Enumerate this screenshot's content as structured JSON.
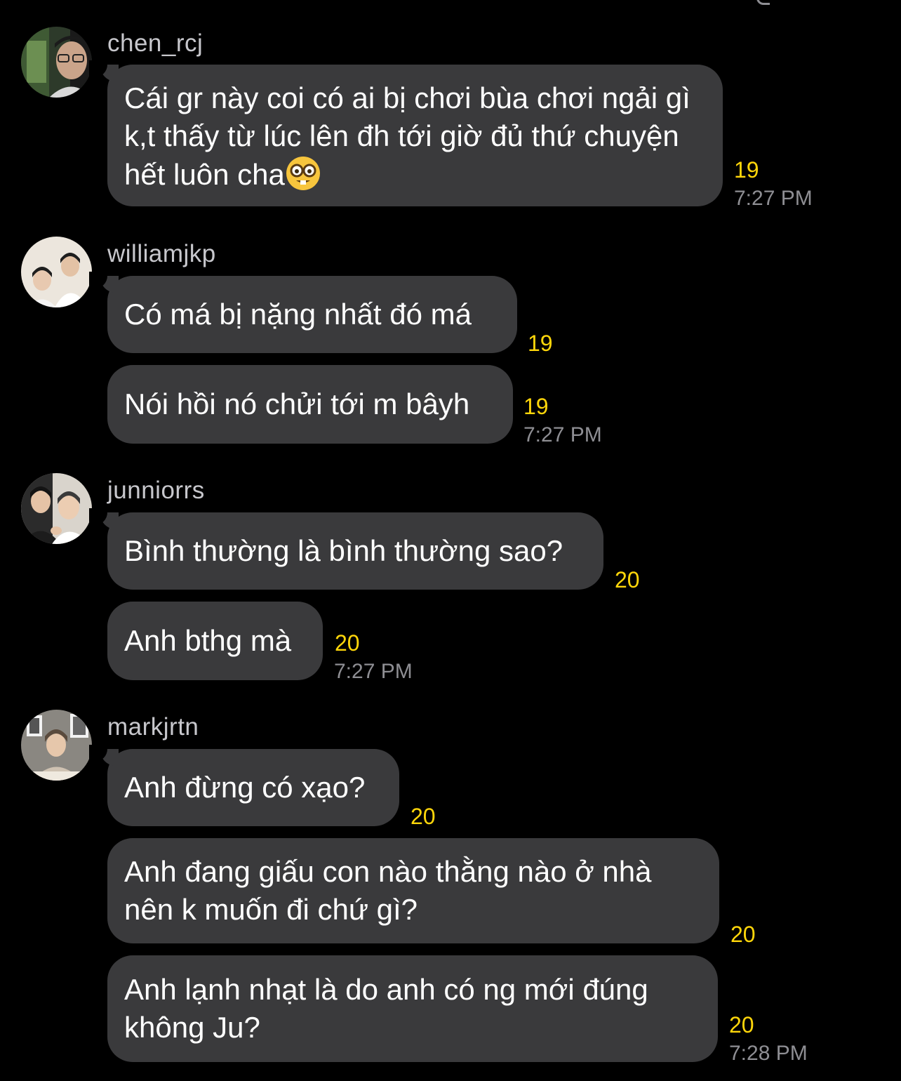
{
  "colors": {
    "background": "#000000",
    "bubble": "#3a3a3c",
    "text": "#ffffff",
    "username": "#c7c7cc",
    "read_count": "#ffd60a",
    "timestamp": "#8e8e93"
  },
  "messages": [
    {
      "user": "chen_rcj",
      "avatar_icon": "avatar-chen_rcj-icon",
      "bubbles": [
        {
          "text": "Cái gr này coi có ai bị chơi bùa chơi ngải gì k,t thấy từ lúc lên đh tới giờ đủ thứ chuyện hết luôn cha",
          "emoji": "nerd-face-icon",
          "read_count": "19",
          "time": "7:27 PM"
        }
      ]
    },
    {
      "user": "williamjkp",
      "avatar_icon": "avatar-williamjkp-icon",
      "bubbles": [
        {
          "text": "Có má bị nặng nhất đó má",
          "read_count": "19"
        },
        {
          "text": "Nói hồi nó chửi tới m bâyh",
          "read_count": "19",
          "time": "7:27 PM"
        }
      ]
    },
    {
      "user": "junniorrs",
      "avatar_icon": "avatar-junniorrs-icon",
      "bubbles": [
        {
          "text": "Bình thường là bình thường sao?",
          "read_count": "20"
        },
        {
          "text": "Anh bthg mà",
          "read_count": "20",
          "time": "7:27 PM"
        }
      ]
    },
    {
      "user": "markjrtn",
      "avatar_icon": "avatar-markjrtn-icon",
      "bubbles": [
        {
          "text": "Anh đừng có xạo?",
          "read_count": "20"
        },
        {
          "text": "Anh đang giấu con nào thằng nào ở nhà nên k muốn đi chứ gì?",
          "read_count": "20"
        },
        {
          "text": "Anh lạnh nhạt là do anh có ng mới đúng không Ju?",
          "read_count": "20",
          "time": "7:28 PM"
        }
      ]
    }
  ]
}
